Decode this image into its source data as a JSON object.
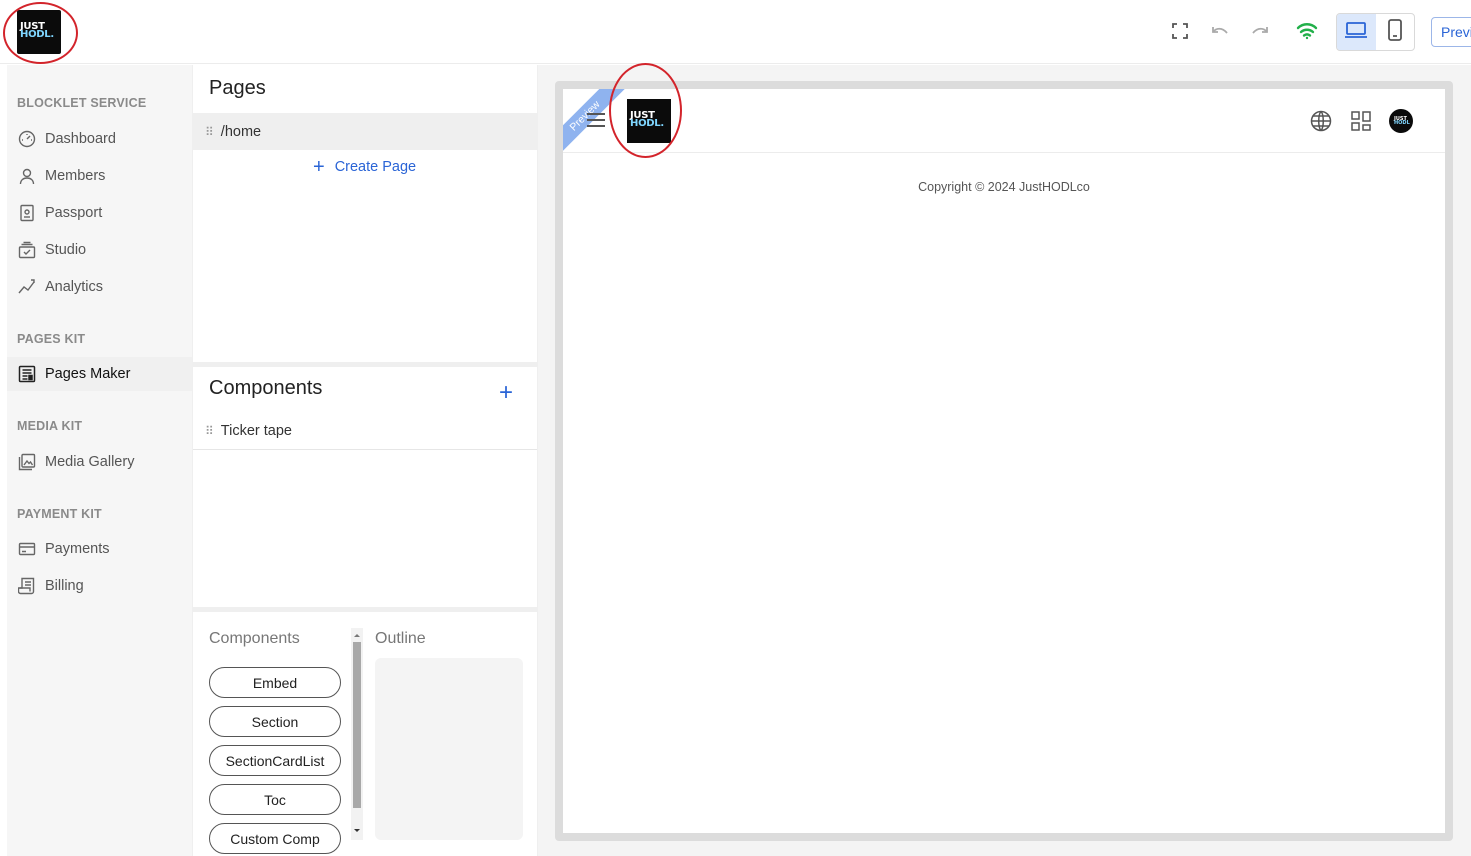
{
  "brand": {
    "logo_line1": "JUST",
    "logo_line2": "HODL."
  },
  "toolbar": {
    "icons": [
      "fullscreen-icon",
      "undo-icon",
      "redo-icon",
      "wifi-icon",
      "laptop-icon",
      "phone-icon"
    ],
    "active_device": "laptop",
    "preview_label": "Preview",
    "accent_color": "#2a64d6",
    "online_color": "#22b04a"
  },
  "sidebar": {
    "sections": [
      {
        "title": "BLOCKLET SERVICE",
        "items": [
          {
            "label": "Dashboard",
            "icon": "dashboard-icon"
          },
          {
            "label": "Members",
            "icon": "person-icon"
          },
          {
            "label": "Passport",
            "icon": "passport-icon"
          },
          {
            "label": "Studio",
            "icon": "studio-icon"
          },
          {
            "label": "Analytics",
            "icon": "analytics-icon"
          }
        ]
      },
      {
        "title": "PAGES KIT",
        "items": [
          {
            "label": "Pages Maker",
            "icon": "pages-maker-icon",
            "selected": true
          }
        ]
      },
      {
        "title": "MEDIA KIT",
        "items": [
          {
            "label": "Media Gallery",
            "icon": "gallery-icon"
          }
        ]
      },
      {
        "title": "PAYMENT KIT",
        "items": [
          {
            "label": "Payments",
            "icon": "card-icon"
          },
          {
            "label": "Billing",
            "icon": "billing-icon"
          }
        ]
      }
    ]
  },
  "pages_panel": {
    "title": "Pages",
    "pages": [
      "/home"
    ],
    "create_label": "Create Page"
  },
  "components_panel": {
    "title": "Components",
    "items": [
      "Ticker tape"
    ]
  },
  "library_panel": {
    "components_title": "Components",
    "outline_title": "Outline",
    "buttons": [
      "Embed",
      "Section",
      "SectionCardList",
      "Toc",
      "Custom Comp"
    ]
  },
  "canvas": {
    "ribbon_label": "Preview",
    "site_logo_line1": "JUST",
    "site_logo_line2": "HODL.",
    "header_icons": [
      "globe-icon",
      "grid-icon"
    ],
    "avatar_line1": "JUST",
    "avatar_line2": "HODL",
    "copyright": "Copyright © 2024 JustHODLco"
  }
}
